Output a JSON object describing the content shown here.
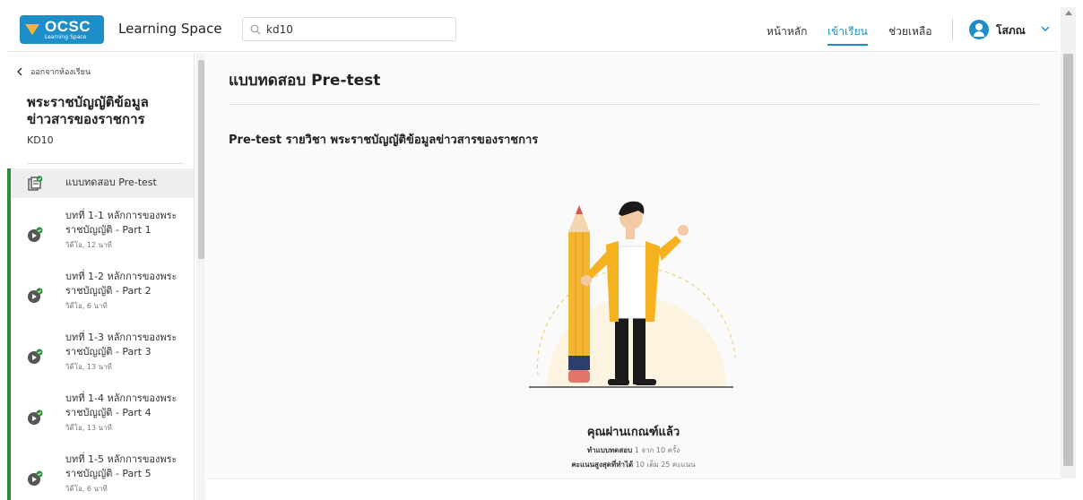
{
  "header": {
    "logo_text": "OCSC",
    "logo_sub": "Learning Space",
    "app_title": "Learning Space",
    "search_value": "kd10",
    "nav": [
      {
        "label": "หน้าหลัก"
      },
      {
        "label": "เข้าเรียน"
      },
      {
        "label": "ช่วยเหลือ"
      }
    ],
    "user_name": "โสภณ"
  },
  "sidebar": {
    "back_label": "ออกจากห้องเรียน",
    "course_title": "พระราชบัญญัติข้อมูลข่าวสารของราชการ",
    "course_code": "KD10",
    "lessons": [
      {
        "title": "แบบทดสอบ Pre-test",
        "meta": ""
      },
      {
        "title": "บทที่ 1-1 หลักการของพระราชบัญญัติ - Part 1",
        "meta": "วิดีโอ, 12 นาที"
      },
      {
        "title": "บทที่ 1-2 หลักการของพระราชบัญญัติ - Part 2",
        "meta": "วิดีโอ, 6 นาที"
      },
      {
        "title": "บทที่ 1-3 หลักการของพระราชบัญญัติ - Part 3",
        "meta": "วิดีโอ, 13 นาที"
      },
      {
        "title": "บทที่ 1-4 หลักการของพระราชบัญญัติ - Part 4",
        "meta": "วิดีโอ, 13 นาที"
      },
      {
        "title": "บทที่ 1-5 หลักการของพระราชบัญญัติ - Part 5",
        "meta": "วิดีโอ, 6 นาที"
      }
    ]
  },
  "main": {
    "title": "แบบทดสอบ Pre-test",
    "subtitle": "Pre-test รายวิชา พระราชบัญญัติข้อมูลข่าวสารของราชการ",
    "result_title": "คุณผ่านเกณฑ์แล้ว",
    "attempts_label": "ทำแบบทดสอบ",
    "attempts_value": "1 จาก 10 ครั้ง",
    "score_label": "คะแนนสูงสุดที่ทำได้",
    "score_value": "10 เต็ม 25 คะแนน"
  },
  "colors": {
    "brand": "#1e8ec9",
    "complete": "#2e8b3c",
    "pencil": "#f2b632",
    "shirt": "#f5b21e"
  }
}
